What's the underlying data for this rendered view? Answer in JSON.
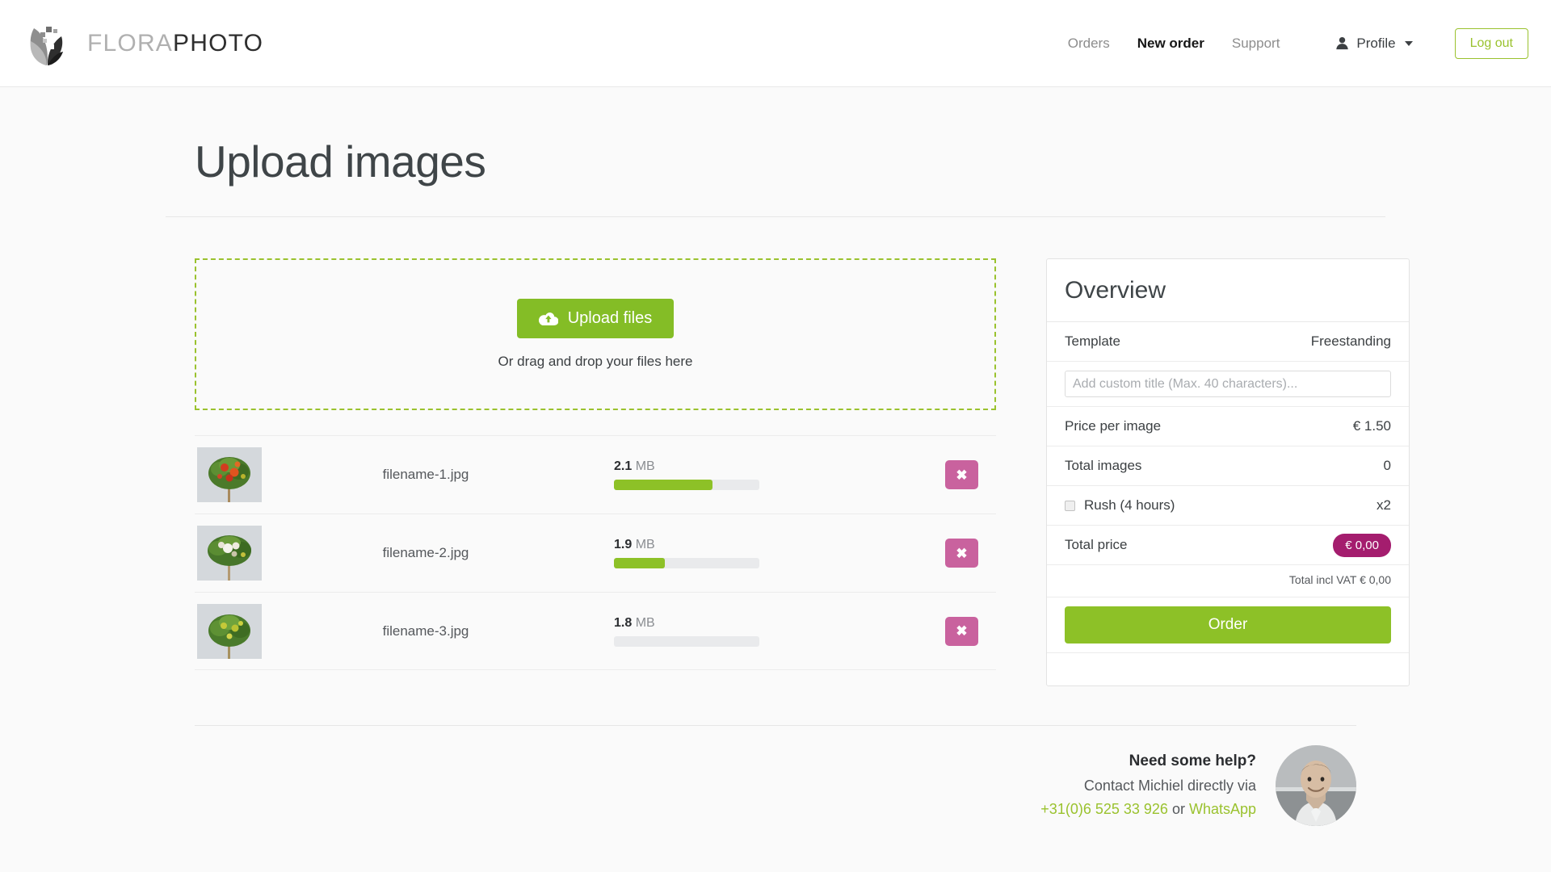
{
  "brand": {
    "part1": "FLORA",
    "part2": "PHOTO"
  },
  "nav": {
    "items": [
      {
        "label": "Orders",
        "active": false
      },
      {
        "label": "New order",
        "active": true
      },
      {
        "label": "Support",
        "active": false
      }
    ],
    "profile_label": "Profile",
    "logout_label": "Log out"
  },
  "page": {
    "title": "Upload images"
  },
  "dropzone": {
    "upload_button": "Upload files",
    "hint": "Or drag and drop your files here"
  },
  "files": [
    {
      "name": "filename-1.jpg",
      "size_value": "2.1",
      "size_unit": "MB",
      "progress": 68,
      "delete_label": "✖"
    },
    {
      "name": "filename-2.jpg",
      "size_value": "1.9",
      "size_unit": "MB",
      "progress": 35,
      "delete_label": "✖"
    },
    {
      "name": "filename-3.jpg",
      "size_value": "1.8",
      "size_unit": "MB",
      "progress": 0,
      "delete_label": "✖"
    }
  ],
  "overview": {
    "heading": "Overview",
    "template_label": "Template",
    "template_value": "Freestanding",
    "custom_title_placeholder": "Add custom title (Max. 40 characters)...",
    "custom_title_value": "",
    "price_label": "Price per image",
    "price_value": "€ 1.50",
    "total_images_label": "Total images",
    "total_images_value": "0",
    "rush_label": "Rush (4 hours)",
    "rush_multiplier": "x2",
    "rush_checked": false,
    "total_price_label": "Total price",
    "total_price_value": "€ 0,00",
    "vat_text": "Total incl VAT € 0,00",
    "order_button": "Order"
  },
  "help": {
    "title": "Need some help?",
    "subtitle": "Contact Michiel directly via",
    "phone": "+31(0)6 525 33 926",
    "or": " or ",
    "whatsapp": "WhatsApp"
  },
  "colors": {
    "green": "#8dc127",
    "green_border": "#9ac22e",
    "pink": "#c9629e",
    "magenta": "#a41d6e"
  }
}
